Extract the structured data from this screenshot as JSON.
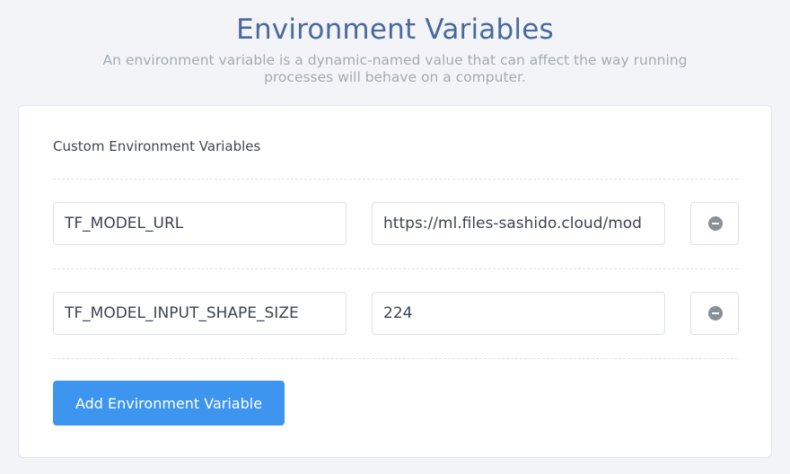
{
  "header": {
    "title": "Environment Variables",
    "subtitle": "An environment variable is a dynamic-named value that can affect the way running processes will behave on a computer."
  },
  "section": {
    "title": "Custom Environment Variables"
  },
  "variables": [
    {
      "name": "TF_MODEL_URL",
      "value": "https://ml.files-sashido.cloud/mod",
      "remove_icon": "minus-circle-icon"
    },
    {
      "name": "TF_MODEL_INPUT_SHAPE_SIZE",
      "value": "224",
      "remove_icon": "minus-circle-icon"
    }
  ],
  "actions": {
    "add_label": "Add Environment Variable"
  },
  "colors": {
    "accent": "#3d95ef",
    "title": "#4a6a9c",
    "background": "#f2f4f8"
  }
}
